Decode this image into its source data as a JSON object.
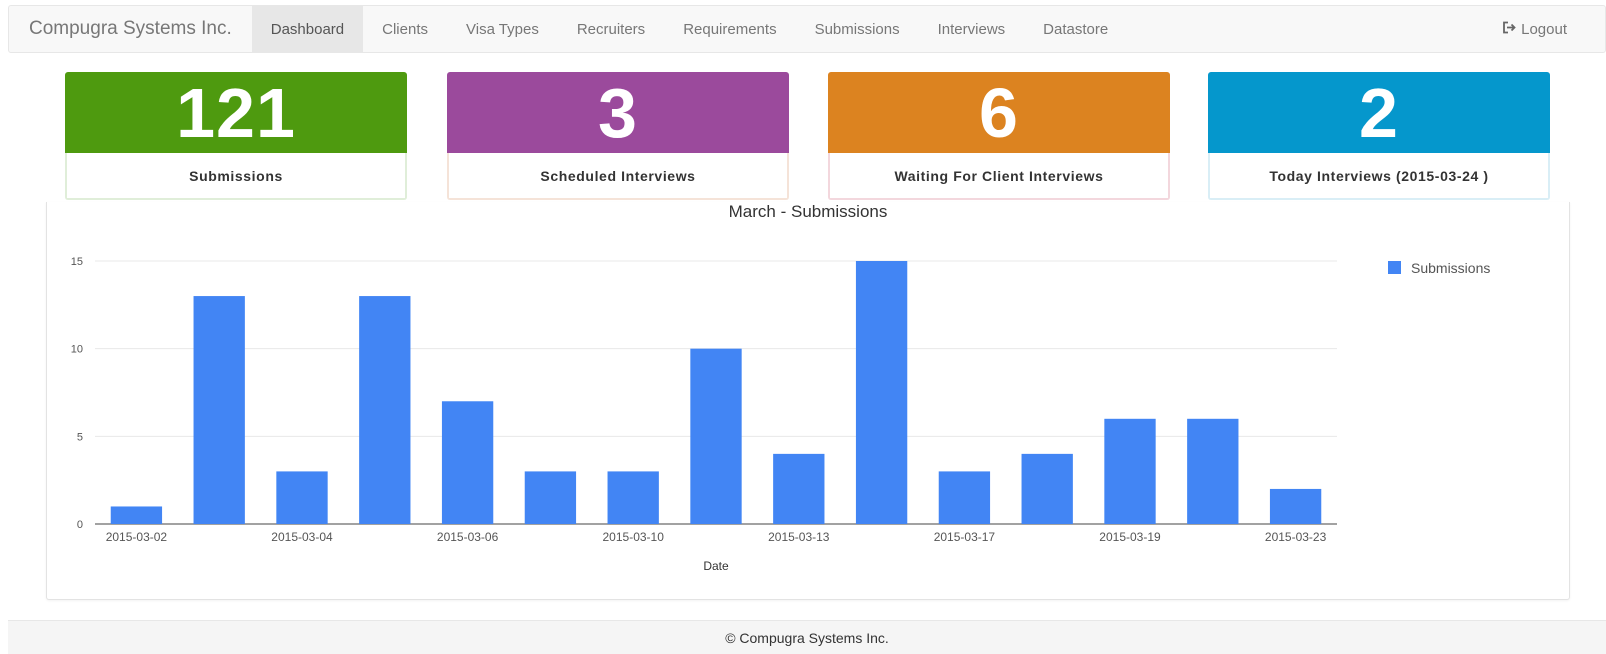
{
  "navbar": {
    "brand": "Compugra Systems Inc.",
    "items": [
      {
        "label": "Dashboard",
        "active": true
      },
      {
        "label": "Clients"
      },
      {
        "label": "Visa Types"
      },
      {
        "label": "Recruiters"
      },
      {
        "label": "Requirements"
      },
      {
        "label": "Submissions"
      },
      {
        "label": "Interviews"
      },
      {
        "label": "Datastore"
      }
    ],
    "logout_icon": "logout-icon",
    "logout_label": "Logout"
  },
  "stats": [
    {
      "value": "121",
      "label": "Submissions",
      "color": "#4e9a0f"
    },
    {
      "value": "3",
      "label": "Scheduled Interviews",
      "color": "#9b4a9c"
    },
    {
      "value": "6",
      "label": "Waiting For Client Interviews",
      "color": "#dc8320"
    },
    {
      "value": "2",
      "label": "Today Interviews (2015-03-24 )",
      "color": "#0597cc"
    }
  ],
  "chart_data": {
    "type": "bar",
    "title": "March - Submissions",
    "xlabel": "Date",
    "ylabel": "",
    "categories": [
      "2015-03-02",
      "2015-03-03",
      "2015-03-04",
      "2015-03-05",
      "2015-03-06",
      "2015-03-09",
      "2015-03-10",
      "2015-03-12",
      "2015-03-13",
      "2015-03-16",
      "2015-03-17",
      "2015-03-18",
      "2015-03-19",
      "2015-03-20",
      "2015-03-23"
    ],
    "tick_labels": [
      "2015-03-02",
      "",
      "2015-03-04",
      "",
      "2015-03-06",
      "",
      "2015-03-10",
      "",
      "2015-03-13",
      "",
      "2015-03-17",
      "",
      "2015-03-19",
      "",
      "2015-03-23"
    ],
    "series": [
      {
        "name": "Submissions",
        "color": "#4285f4",
        "values": [
          1,
          13,
          3,
          13,
          7,
          3,
          3,
          10,
          4,
          15,
          3,
          4,
          6,
          6,
          2
        ]
      }
    ],
    "yticks": [
      "0",
      "5",
      "10",
      "15"
    ],
    "ylim": [
      0,
      15
    ],
    "grid": true,
    "legend": "right"
  },
  "footer": {
    "text": "© Compugra Systems Inc."
  }
}
